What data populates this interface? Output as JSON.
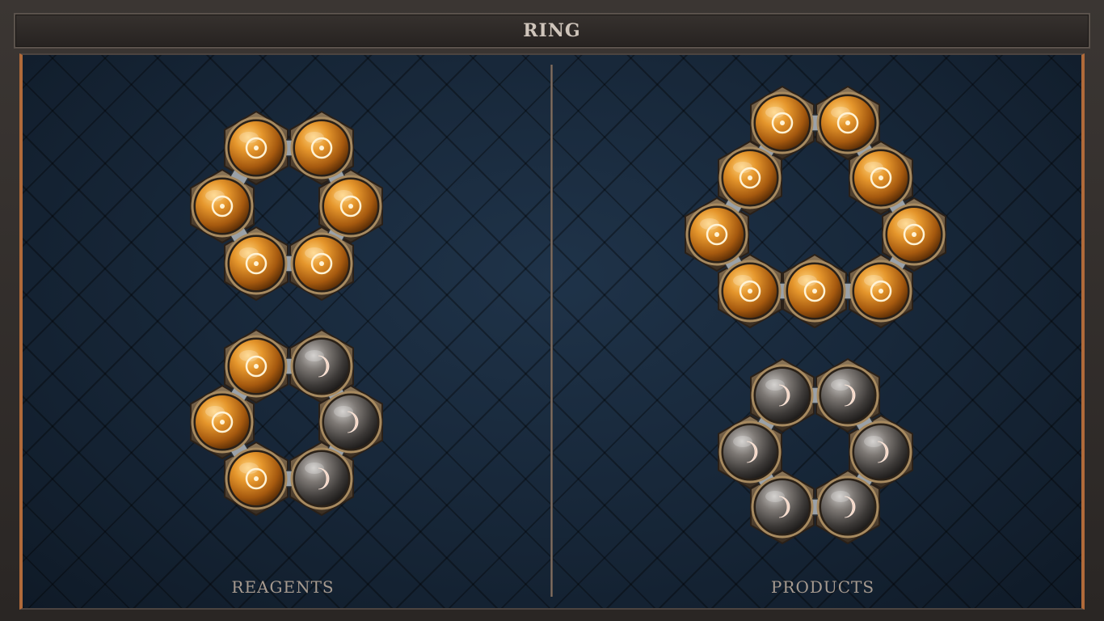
{
  "title": "RING",
  "sections": {
    "reagents_label": "REAGENTS",
    "products_label": "PRODUCTS"
  },
  "colors": {
    "fire_atom": "#d4861e",
    "moon_atom": "#5a5654",
    "frame_accent": "#b06a3a",
    "panel_bg": "#1a2a3c"
  },
  "atom_types": {
    "fire": "fire-element-icon",
    "moon": "moon-element-icon"
  },
  "molecules": {
    "reagents": [
      {
        "name": "fire-ring",
        "atoms": [
          "fire",
          "fire",
          "fire",
          "fire",
          "fire",
          "fire"
        ]
      },
      {
        "name": "fire-moon-ring",
        "atoms": [
          "fire",
          "moon",
          "moon",
          "moon",
          "fire",
          "fire"
        ]
      }
    ],
    "products": [
      {
        "name": "large-fire-ring",
        "atoms": [
          "fire",
          "fire",
          "fire",
          "fire",
          "fire",
          "fire",
          "fire",
          "fire",
          "fire"
        ]
      },
      {
        "name": "moon-ring",
        "atoms": [
          "moon",
          "moon",
          "moon",
          "moon",
          "moon",
          "moon"
        ]
      }
    ]
  }
}
